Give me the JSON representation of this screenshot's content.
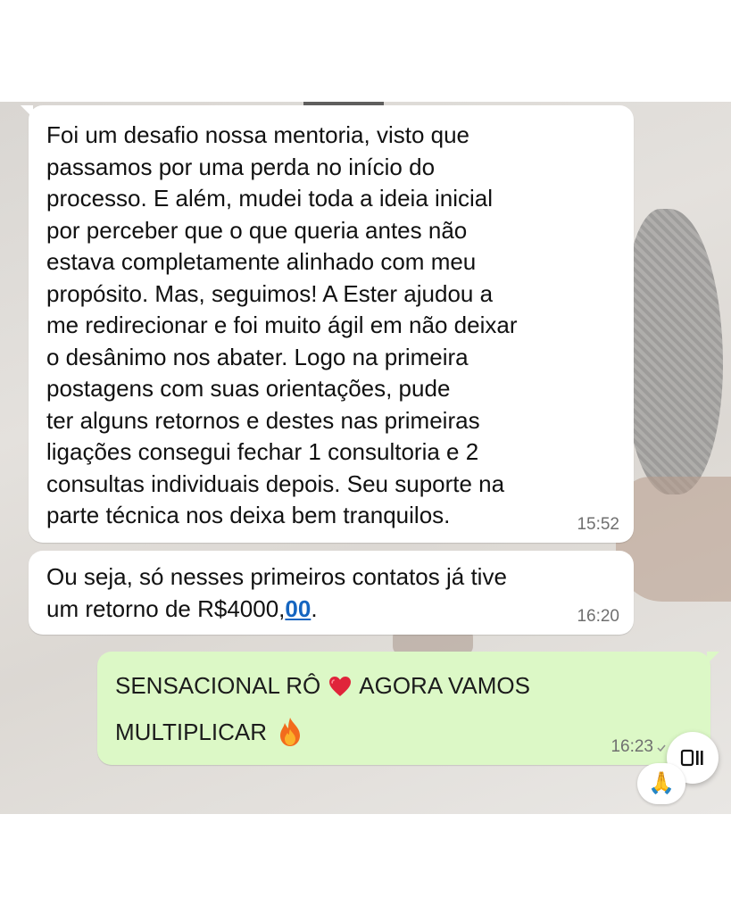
{
  "messages": [
    {
      "direction": "incoming",
      "text": "Foi um desafio nossa mentoria, visto que\npassamos por uma perda no início do\nprocesso. E além, mudei toda a ideia inicial\npor perceber que o que queria antes não\nestava completamente alinhado com meu\npropósito. Mas, seguimos! A Ester ajudou a\nme redirecionar e foi muito ágil em não deixar\no desânimo nos abater. Logo na primeira\npostagens com suas orientações, pude\nter alguns retornos e destes nas primeiras\nligações consegui fechar 1 consultoria e 2\nconsultas individuais depois. Seu suporte na\nparte técnica nos deixa bem tranquilos.",
      "time": "15:52"
    },
    {
      "direction": "incoming",
      "text_prefix": "Ou seja, só nesses primeiros contatos já tive\num retorno de R$4000,",
      "text_link": "00",
      "text_suffix": ".",
      "time": "16:20"
    },
    {
      "direction": "outgoing",
      "line1_before_emoji": "SENSACIONAL RÔ",
      "line1_after_emoji": "AGORA VAMOS",
      "line2": "MULTIPLICAR",
      "emoji_1": "red-heart-icon",
      "emoji_2": "fire-icon",
      "time": "16:23"
    }
  ],
  "reaction": {
    "emoji": "🙏",
    "icon": "folded-hands-icon"
  },
  "floating_button": {
    "icon": "pause-video-icon"
  },
  "colors": {
    "incoming_bubble": "#ffffff",
    "outgoing_bubble": "#dcf8c6",
    "link": "#1565c0",
    "timestamp": "#6f6f6f"
  }
}
